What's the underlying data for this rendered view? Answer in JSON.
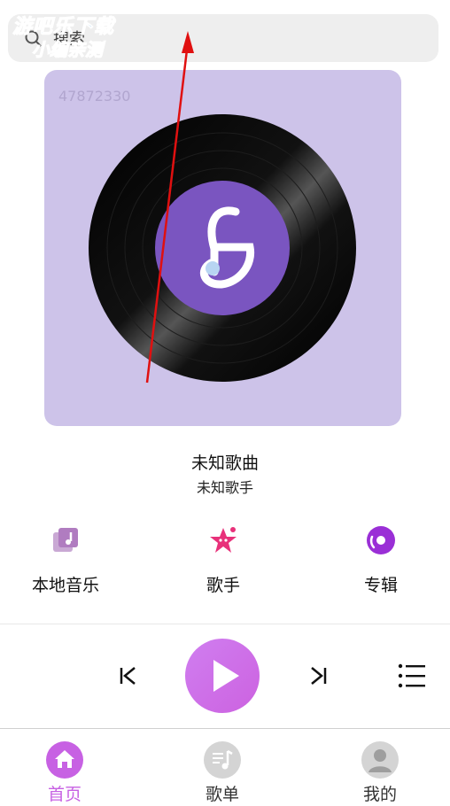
{
  "search": {
    "placeholder": "搜索"
  },
  "watermark": {
    "line1": "游吧乐下载",
    "line2": "小编亲测"
  },
  "cover": {
    "id_text": "47872330"
  },
  "now_playing": {
    "title": "未知歌曲",
    "artist": "未知歌手"
  },
  "categories": [
    {
      "label": "本地音乐",
      "icon": "local-music-icon"
    },
    {
      "label": "歌手",
      "icon": "singer-star-icon"
    },
    {
      "label": "专辑",
      "icon": "album-disc-icon"
    }
  ],
  "tabs": [
    {
      "label": "首页",
      "icon": "home-icon",
      "active": true
    },
    {
      "label": "歌单",
      "icon": "playlist-note-icon",
      "active": false
    },
    {
      "label": "我的",
      "icon": "profile-icon",
      "active": false
    }
  ],
  "colors": {
    "accent": "#c761e3",
    "cover_bg": "#cdc3e9",
    "vinyl_center": "#7a55c0",
    "annotation": "#e01010"
  }
}
